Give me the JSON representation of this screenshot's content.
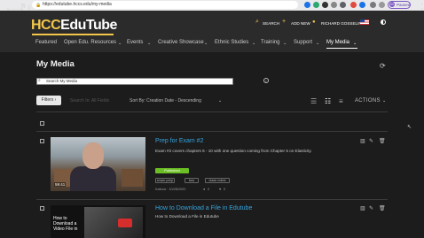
{
  "browser": {
    "url": "https://edutube.hccs.edu/my-media",
    "profile_status": "Paused",
    "profile_initial": "M"
  },
  "header": {
    "logo_main": "HCC",
    "logo_sub": "EduTube",
    "search_label": "SEARCH",
    "add_new_label": "ADD NEW",
    "user_name": "RICHARD GOSSELIN"
  },
  "menu": {
    "items": [
      "Featured",
      "Open Edu. Resources",
      "Events",
      "Creative Showcase",
      "Ethnic Studies",
      "Training",
      "Support",
      "My Media"
    ],
    "active": "My Media"
  },
  "page": {
    "title": "My Media",
    "search_placeholder": "Search My Media",
    "filters_label": "Filters",
    "search_in": "Search In: All Fields",
    "sort_by": "Sort By: Creation Date - Descending",
    "actions_label": "ACTIONS"
  },
  "items": [
    {
      "title": "Prep for Exam #2",
      "description": "Exam #2 covers chapters 6 - 10 with one question coming from Chapter 5 on Elasticity.",
      "duration": "59:41",
      "status": "Published",
      "tags": [
        "exam prep",
        "bus",
        "class notes"
      ],
      "meta": "Kaltura · 10/28/2020",
      "views": "0",
      "likes": "0"
    },
    {
      "title": "How to Download a File in Edutube",
      "description": "How to Download a File in Edutube",
      "thumb_text": "How to Download a Video File in"
    }
  ],
  "colors": {
    "accent": "#f2c64a",
    "link": "#37a3dc",
    "published": "#6bbf24",
    "background": "#1c1c1c"
  }
}
